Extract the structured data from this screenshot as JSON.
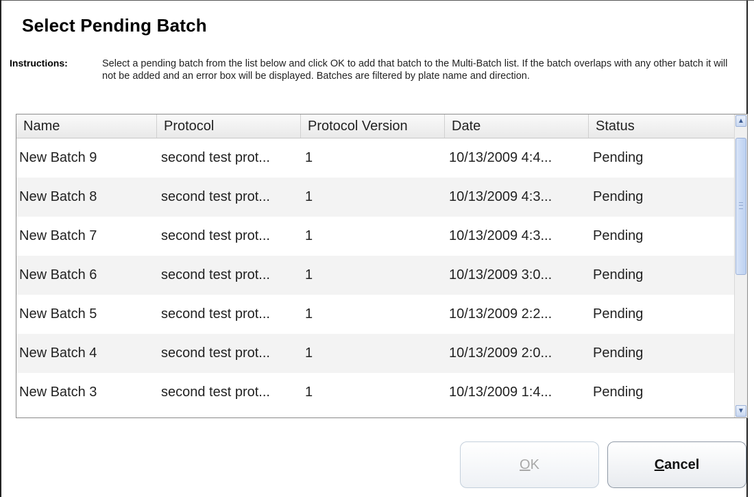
{
  "dialog": {
    "title": "Select Pending Batch",
    "instructions_label": "Instructions:",
    "instructions_text": "Select a pending batch from the list below and click OK to add that batch to the Multi-Batch list. If the batch overlaps with any other batch it will not be added and an error box will be displayed. Batches are filtered by plate name and direction."
  },
  "grid": {
    "columns": [
      "Name",
      "Protocol",
      "Protocol Version",
      "Date",
      "Status"
    ],
    "rows": [
      {
        "name": "New Batch 9",
        "protocol": "second test prot...",
        "version": "1",
        "date": "10/13/2009 4:4...",
        "status": "Pending"
      },
      {
        "name": "New Batch 8",
        "protocol": "second test prot...",
        "version": "1",
        "date": "10/13/2009 4:3...",
        "status": "Pending"
      },
      {
        "name": "New Batch 7",
        "protocol": "second test prot...",
        "version": "1",
        "date": "10/13/2009 4:3...",
        "status": "Pending"
      },
      {
        "name": "New Batch 6",
        "protocol": "second test prot...",
        "version": "1",
        "date": "10/13/2009 3:0...",
        "status": "Pending"
      },
      {
        "name": "New Batch 5",
        "protocol": "second test prot...",
        "version": "1",
        "date": "10/13/2009 2:2...",
        "status": "Pending"
      },
      {
        "name": "New Batch 4",
        "protocol": "second test prot...",
        "version": "1",
        "date": "10/13/2009 2:0...",
        "status": "Pending"
      },
      {
        "name": "New Batch 3",
        "protocol": "second test prot...",
        "version": "1",
        "date": "10/13/2009 1:4...",
        "status": "Pending"
      }
    ]
  },
  "buttons": {
    "ok_mnemonic": "O",
    "ok_rest": "K",
    "ok_enabled": false,
    "cancel_mnemonic": "C",
    "cancel_rest": "ancel"
  },
  "icons": {
    "scroll_up": "chevron-up-icon",
    "scroll_down": "chevron-down-icon"
  }
}
